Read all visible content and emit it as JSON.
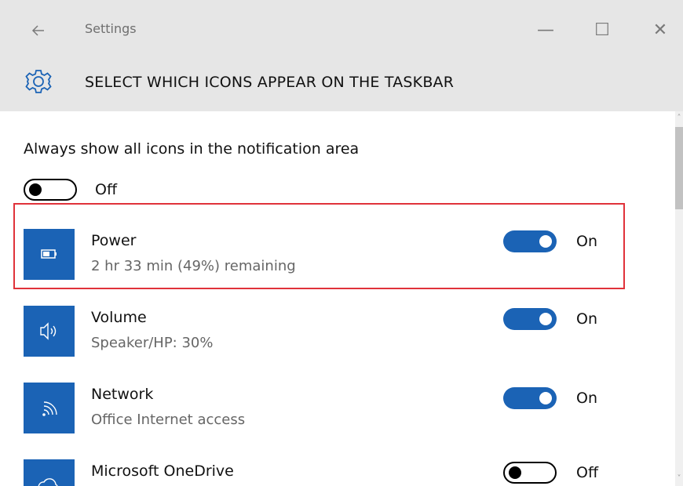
{
  "window": {
    "back_icon": "back-arrow-icon",
    "app_title": "Settings",
    "minimize_glyph": "—",
    "maximize_glyph": "☐",
    "close_glyph": "✕"
  },
  "header": {
    "icon": "gear-icon",
    "title": "SELECT WHICH ICONS APPEAR ON THE TASKBAR"
  },
  "always_show": {
    "label": "Always show all icons in the notification area",
    "state": "Off",
    "enabled": false
  },
  "items": [
    {
      "name": "Power",
      "detail": "2 hr 33 min (49%) remaining",
      "state": "On",
      "enabled": true,
      "icon": "battery-icon",
      "highlighted": true
    },
    {
      "name": "Volume",
      "detail": "Speaker/HP: 30%",
      "state": "On",
      "enabled": true,
      "icon": "speaker-icon"
    },
    {
      "name": "Network",
      "detail": "Office Internet access",
      "state": "On",
      "enabled": true,
      "icon": "wifi-icon"
    },
    {
      "name": "Microsoft OneDrive",
      "detail": "",
      "state": "Off",
      "enabled": false,
      "icon": "cloud-icon"
    }
  ],
  "colors": {
    "accent": "#1b63b5",
    "titlebar_bg": "#e6e6e6",
    "highlight": "#e0323a"
  }
}
